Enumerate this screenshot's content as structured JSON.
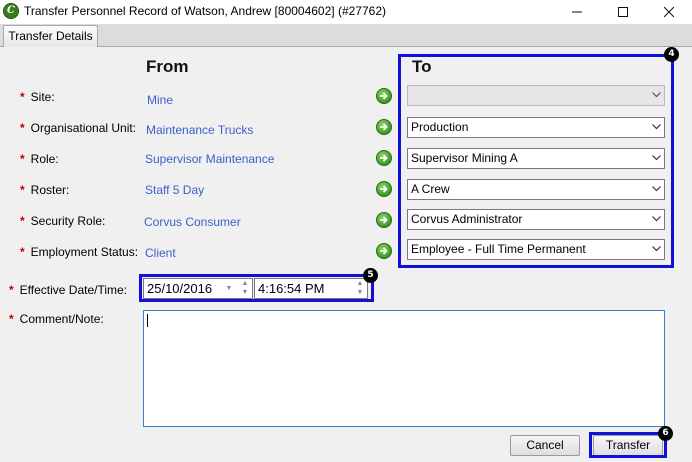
{
  "window": {
    "title": "Transfer Personnel Record of Watson, Andrew [80004602] (#27762)",
    "app_icon": "corvus-logo-icon",
    "minimize_icon": "minimize-icon",
    "maximize_icon": "maximize-icon",
    "close_icon": "close-icon"
  },
  "tabs": [
    {
      "label": "Transfer Details",
      "active": true
    }
  ],
  "headers": {
    "from": "From",
    "to": "To"
  },
  "required_marker": "*",
  "rows": [
    {
      "label": "Site:",
      "from": "Mine",
      "to": ""
    },
    {
      "label": "Organisational Unit:",
      "from": "Maintenance Trucks",
      "to": "Production"
    },
    {
      "label": "Role:",
      "from": "Supervisor Maintenance",
      "to": "Supervisor Mining A"
    },
    {
      "label": "Roster:",
      "from": "Staff 5 Day",
      "to": "A Crew"
    },
    {
      "label": "Security Role:",
      "from": "Corvus Consumer",
      "to": "Corvus Administrator"
    },
    {
      "label": "Employment Status:",
      "from": "Client",
      "to": "Employee - Full Time Permanent"
    }
  ],
  "effective": {
    "label": "Effective Date/Time:",
    "date": "25/10/2016",
    "time": "4:16:54 PM"
  },
  "comment": {
    "label": "Comment/Note:",
    "value": ""
  },
  "buttons": {
    "cancel": "Cancel",
    "transfer": "Transfer"
  },
  "callouts": {
    "to_panel": "4",
    "effective": "5",
    "transfer": "6"
  },
  "colors": {
    "accent_blue": "#1010d8",
    "link_blue": "#3a5fcd",
    "required_red": "#c00000",
    "arrow_green": "#3a9b22"
  }
}
